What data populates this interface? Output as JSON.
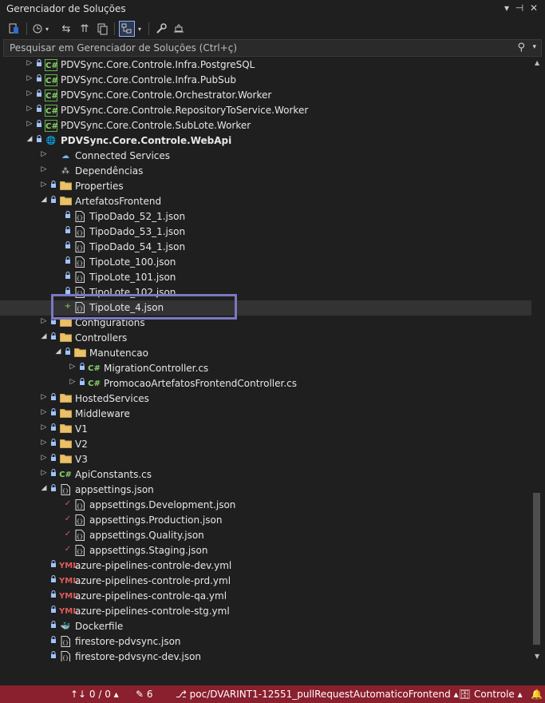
{
  "titlebar": {
    "title": "Gerenciador de Soluções",
    "dropdown_icon": "▾",
    "pin_icon": "⊣",
    "close_icon": "✕"
  },
  "toolbar": {
    "icons": [
      "solution-home",
      "history",
      "sync",
      "collapse",
      "copy",
      "show-all",
      "chevron-down",
      "properties",
      "preview"
    ]
  },
  "search": {
    "placeholder": "Pesquisar em Gerenciador de Soluções (Ctrl+ç)",
    "icon": "⚲",
    "drop": "▾"
  },
  "tree": {
    "items": [
      {
        "label": "PDVSync.Core.Controle.Infra.PostgreSQL",
        "exp": "▷",
        "status": "🔒",
        "icon": "C#",
        "type": "proj"
      },
      {
        "label": "PDVSync.Core.Controle.Infra.PubSub",
        "exp": "▷",
        "status": "🔒",
        "icon": "C#",
        "type": "proj"
      },
      {
        "label": "PDVSync.Core.Controle.Orchestrator.Worker",
        "exp": "▷",
        "status": "🔒",
        "icon": "C#",
        "type": "proj"
      },
      {
        "label": "PDVSync.Core.Controle.RepositoryToService.Worker",
        "exp": "▷",
        "status": "🔒",
        "icon": "C#",
        "type": "proj"
      },
      {
        "label": "PDVSync.Core.Controle.SubLote.Worker",
        "exp": "▷",
        "status": "🔒",
        "icon": "C#",
        "type": "proj"
      },
      {
        "label": "PDVSync.Core.Controle.WebApi",
        "exp": "◢",
        "status": "🔒",
        "icon": "🌐",
        "type": "web"
      },
      {
        "label": "Connected Services",
        "exp": "▷",
        "status": "",
        "icon": "☁",
        "type": "cloud"
      },
      {
        "label": "Dependências",
        "exp": "▷",
        "status": "",
        "icon": "⁂",
        "type": "dep"
      },
      {
        "label": "Properties",
        "exp": "▷",
        "status": "🔒",
        "icon": "🗀",
        "type": "folder"
      },
      {
        "label": "ArtefatosFrontend",
        "exp": "◢",
        "status": "🔒",
        "icon": "🗀",
        "type": "folder"
      },
      {
        "label": "TipoDado_52_1.json",
        "exp": "",
        "status": "🔒",
        "icon": "{}",
        "type": "json"
      },
      {
        "label": "TipoDado_53_1.json",
        "exp": "",
        "status": "🔒",
        "icon": "{}",
        "type": "json"
      },
      {
        "label": "TipoDado_54_1.json",
        "exp": "",
        "status": "🔒",
        "icon": "{}",
        "type": "json"
      },
      {
        "label": "TipoLote_100.json",
        "exp": "",
        "status": "🔒",
        "icon": "{}",
        "type": "json"
      },
      {
        "label": "TipoLote_101.json",
        "exp": "",
        "status": "🔒",
        "icon": "{}",
        "type": "json"
      },
      {
        "label": "TipoLote_102.json",
        "exp": "",
        "status": "🔒",
        "icon": "{}",
        "type": "json"
      },
      {
        "label": "TipoLote_4.json",
        "exp": "",
        "status": "+",
        "icon": "{}",
        "type": "json",
        "selected": true
      },
      {
        "label": "Configurations",
        "exp": "▷",
        "status": "🔒",
        "icon": "🗀",
        "type": "folder"
      },
      {
        "label": "Controllers",
        "exp": "◢",
        "status": "🔒",
        "icon": "🗀",
        "type": "folder"
      },
      {
        "label": "Manutencao",
        "exp": "◢",
        "status": "🔒",
        "icon": "🗀",
        "type": "folder"
      },
      {
        "label": "MigrationController.cs",
        "exp": "▷",
        "status": "🔒",
        "icon": "C#",
        "type": "cs"
      },
      {
        "label": "PromocaoArtefatosFrontendController.cs",
        "exp": "▷",
        "status": "🔒",
        "icon": "C#",
        "type": "cs"
      },
      {
        "label": "HostedServices",
        "exp": "▷",
        "status": "🔒",
        "icon": "🗀",
        "type": "folder"
      },
      {
        "label": "Middleware",
        "exp": "▷",
        "status": "🔒",
        "icon": "🗀",
        "type": "folder"
      },
      {
        "label": "V1",
        "exp": "▷",
        "status": "🔒",
        "icon": "🗀",
        "type": "folder"
      },
      {
        "label": "V2",
        "exp": "▷",
        "status": "🔒",
        "icon": "🗀",
        "type": "folder"
      },
      {
        "label": "V3",
        "exp": "▷",
        "status": "🔒",
        "icon": "🗀",
        "type": "folder"
      },
      {
        "label": "ApiConstants.cs",
        "exp": "▷",
        "status": "🔒",
        "icon": "C#",
        "type": "cs"
      },
      {
        "label": "appsettings.json",
        "exp": "◢",
        "status": "🔒",
        "icon": "{}",
        "type": "json"
      },
      {
        "label": "appsettings.Development.json",
        "exp": "",
        "status": "✓",
        "icon": "{}",
        "type": "json"
      },
      {
        "label": "appsettings.Production.json",
        "exp": "",
        "status": "✓",
        "icon": "{}",
        "type": "json"
      },
      {
        "label": "appsettings.Quality.json",
        "exp": "",
        "status": "✓",
        "icon": "{}",
        "type": "json"
      },
      {
        "label": "appsettings.Staging.json",
        "exp": "",
        "status": "✓",
        "icon": "{}",
        "type": "json"
      },
      {
        "label": "azure-pipelines-controle-dev.yml",
        "exp": "",
        "status": "🔒",
        "icon": "YML",
        "type": "yml"
      },
      {
        "label": "azure-pipelines-controle-prd.yml",
        "exp": "",
        "status": "🔒",
        "icon": "YML",
        "type": "yml"
      },
      {
        "label": "azure-pipelines-controle-qa.yml",
        "exp": "",
        "status": "🔒",
        "icon": "YML",
        "type": "yml"
      },
      {
        "label": "azure-pipelines-controle-stg.yml",
        "exp": "",
        "status": "🔒",
        "icon": "YML",
        "type": "yml"
      },
      {
        "label": "Dockerfile",
        "exp": "",
        "status": "🔒",
        "icon": "🐳",
        "type": "docker"
      },
      {
        "label": "firestore-pdvsync.json",
        "exp": "",
        "status": "🔒",
        "icon": "{}",
        "type": "json"
      },
      {
        "label": "firestore-pdvsync-dev.json",
        "exp": "",
        "status": "🔒",
        "icon": "{}",
        "type": "json"
      }
    ]
  },
  "scrollbar": {
    "up": "▲",
    "down": "▼"
  },
  "statusbar": {
    "changes": "↑↓ 0 / 0 ▴",
    "edits": "✎ 6",
    "branch": "⎇ poc/DVARINT1-12551_pullRequestAutomaticoFrontend ▴",
    "repo": "🗄 Controle ▴",
    "bell": "🔔"
  }
}
